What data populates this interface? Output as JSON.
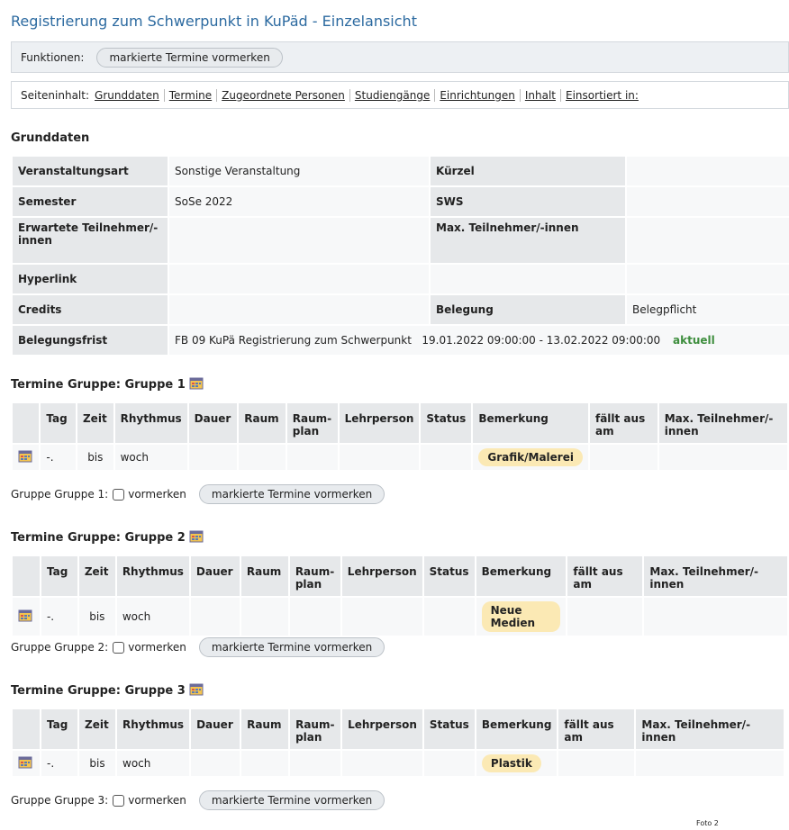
{
  "title": "Registrierung zum Schwerpunkt in KuPäd - Einzelansicht",
  "functions": {
    "label": "Funktionen:",
    "button": "markierte Termine vormerken"
  },
  "contents": {
    "label": "Seiteninhalt:",
    "links": [
      "Grunddaten",
      "Termine",
      "Zugeordnete Personen",
      "Studiengänge",
      "Einrichtungen",
      "Inhalt",
      "Einsortiert in:"
    ]
  },
  "grunddaten": {
    "heading": "Grunddaten",
    "veranstaltungsart_label": "Veranstaltungsart",
    "veranstaltungsart": "Sonstige Veranstaltung",
    "kuerzel_label": "Kürzel",
    "semester_label": "Semester",
    "semester": "SoSe 2022",
    "sws_label": "SWS",
    "erwartete_label": "Erwartete Teilnehmer/-innen",
    "max_label": "Max. Teilnehmer/-innen",
    "hyperlink_label": "Hyperlink",
    "credits_label": "Credits",
    "belegung_label": "Belegung",
    "belegung": "Belegpflicht",
    "frist_label": "Belegungsfrist",
    "frist_name": "FB 09 KuPä Registrierung zum Schwerpunkt",
    "frist_dates": "19.01.2022 09:00:00 - 13.02.2022 09:00:00",
    "frist_status": "aktuell"
  },
  "headers": {
    "tag": "Tag",
    "zeit": "Zeit",
    "rhythmus": "Rhythmus",
    "dauer": "Dauer",
    "raum": "Raum",
    "raumplan": "Raum-plan",
    "lehrperson": "Lehrperson",
    "status": "Status",
    "bemerkung": "Bemerkung",
    "faellt": "fällt aus am",
    "max": "Max. Teilnehmer/-innen"
  },
  "groups": [
    {
      "heading": "Termine Gruppe: Gruppe 1",
      "tag": "-.",
      "zeit": "bis",
      "rhythmus": "woch",
      "bemerkung": "Grafik/Malerei",
      "footer_label": "Gruppe Gruppe 1:",
      "checkbox_label": "vormerken",
      "button": "markierte Termine vormerken"
    },
    {
      "heading": "Termine Gruppe: Gruppe 2",
      "tag": "-.",
      "zeit": "bis",
      "rhythmus": "woch",
      "bemerkung": "Neue Medien",
      "footer_label": "Gruppe Gruppe 2:",
      "checkbox_label": "vormerken",
      "button": "markierte Termine vormerken"
    },
    {
      "heading": "Termine Gruppe: Gruppe 3",
      "tag": "-.",
      "zeit": "bis",
      "rhythmus": "woch",
      "bemerkung": "Plastik",
      "footer_label": "Gruppe Gruppe 3:",
      "checkbox_label": "vormerken",
      "button": "markierte Termine vormerken"
    }
  ],
  "footer_note": "Foto 2",
  "colors": {
    "title": "#2c6aa0",
    "label_bg": "#e6e8ea",
    "highlight": "#fbe9b4",
    "aktuell": "#3e8e3e"
  }
}
